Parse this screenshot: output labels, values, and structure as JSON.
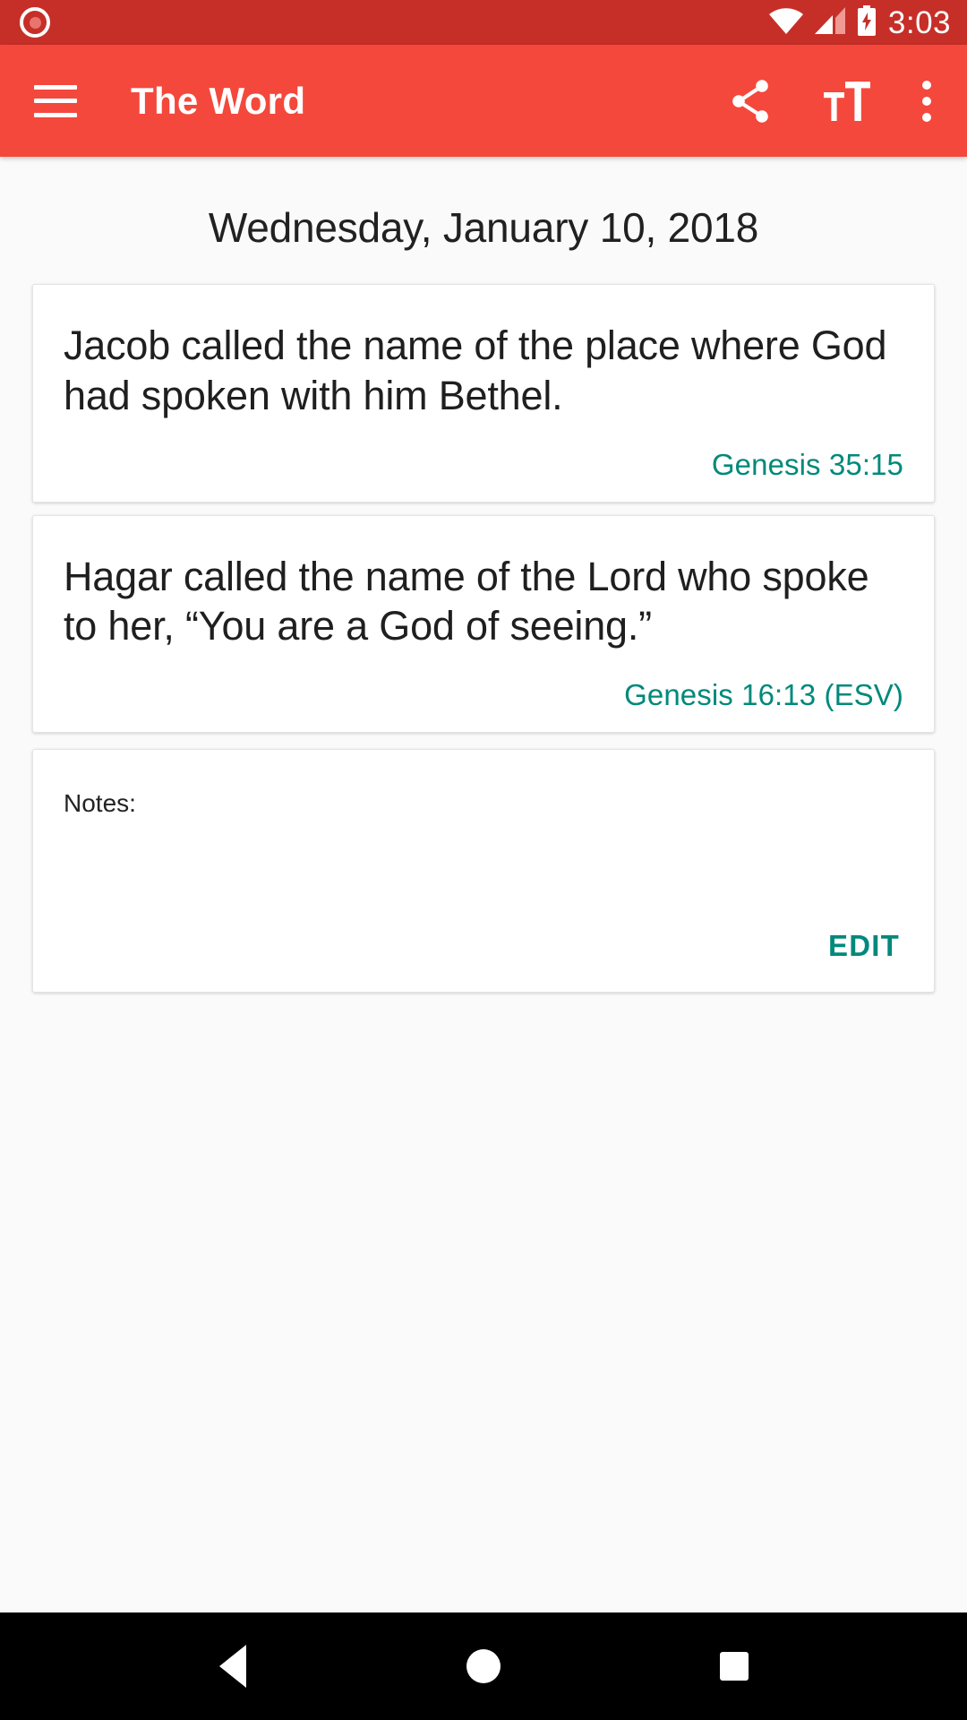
{
  "status_bar": {
    "record_icon": "record-icon",
    "wifi_icon": "wifi-icon",
    "cellular_icon": "cellular-signal-icon",
    "battery_icon": "battery-charging-icon",
    "time": "3:03",
    "background_color": "#c62f28"
  },
  "app_bar": {
    "menu_label": "menu-icon",
    "title": "The Word",
    "share_label": "share-icon",
    "text_size_label": "text-size-icon",
    "overflow_label": "more-options-icon",
    "background_color": "#f4483c"
  },
  "main": {
    "date": "Wednesday, January 10, 2018",
    "verses": [
      {
        "text": "Jacob called the name of the place where God had spoken with him Bethel.",
        "reference": "Genesis 35:15"
      },
      {
        "text": "Hagar called the name of the Lord who spoke to her, “You are a God of seeing.”",
        "reference": "Genesis 16:13 (ESV)"
      }
    ],
    "notes": {
      "label": "Notes:",
      "value": "",
      "edit_label": "EDIT"
    },
    "accent_color": "#00897a",
    "background_color": "#fafafa"
  },
  "nav_bar": {
    "back_label": "back-button",
    "home_label": "home-button",
    "recents_label": "recent-apps-button",
    "background_color": "#000000"
  }
}
